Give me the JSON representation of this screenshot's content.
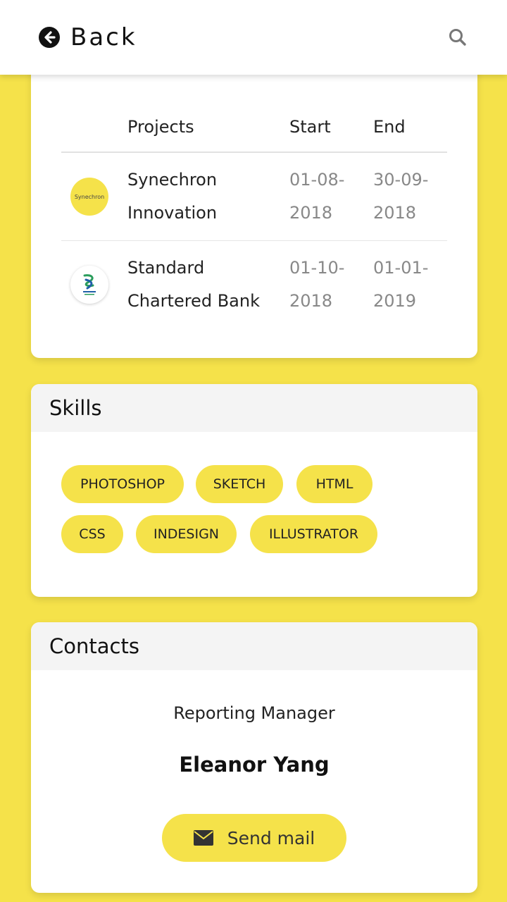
{
  "header": {
    "back_label": "Back",
    "back_icon": "arrow-circle-left-icon",
    "search_icon": "search-icon"
  },
  "projects": {
    "columns": [
      "Projects",
      "Start",
      "End"
    ],
    "rows": [
      {
        "logo_text": "Synechron",
        "name_line1": "Synechron",
        "name_line2": "Innovation",
        "start_line1": "01-08-",
        "start_line2": "2018",
        "end_line1": "30-09-",
        "end_line2": "2018"
      },
      {
        "logo_text": "",
        "name_line1": "Standard",
        "name_line2": "Chartered Bank",
        "start_line1": "01-10-",
        "start_line2": "2018",
        "end_line1": "01-01-",
        "end_line2": "2019"
      }
    ]
  },
  "skills": {
    "title": "Skills",
    "items": [
      "PHOTOSHOP",
      "SKETCH",
      "HTML",
      "CSS",
      "INDESIGN",
      "ILLUSTRATOR"
    ]
  },
  "contacts": {
    "title": "Contacts",
    "role": "Reporting Manager",
    "name": "Eleanor Yang",
    "mail_label": "Send mail",
    "mail_icon": "envelope-icon"
  },
  "colors": {
    "accent": "#f5e24a",
    "card": "#ffffff",
    "header_bg": "#f4f4f4"
  }
}
